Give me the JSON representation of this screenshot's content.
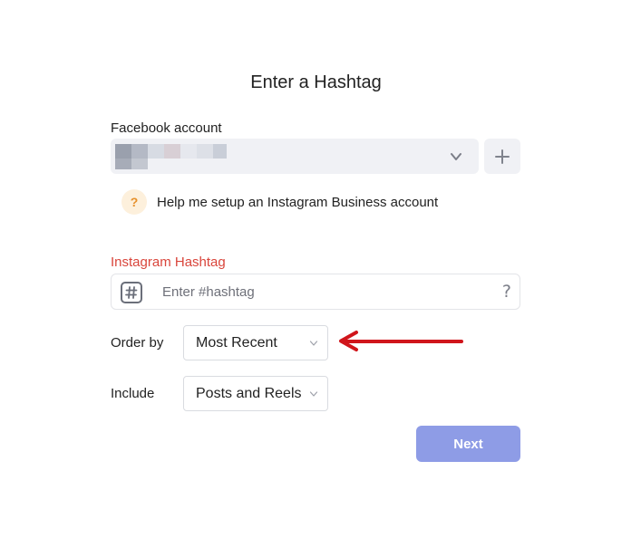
{
  "title": "Enter a Hashtag",
  "facebook": {
    "label": "Facebook account",
    "selected_account": "",
    "add_icon": "plus-icon",
    "dropdown_icon": "chevron-down-icon"
  },
  "help": {
    "icon_glyph": "?",
    "text": "Help me setup an Instagram Business account"
  },
  "instagram": {
    "label": "Instagram Hashtag",
    "label_color": "#d9453b",
    "placeholder": "Enter #hashtag",
    "value": "",
    "prefix_icon": "hash-icon",
    "help_glyph": "?"
  },
  "order_by": {
    "label": "Order by",
    "selected": "Most Recent"
  },
  "include": {
    "label": "Include",
    "selected": "Posts and Reels"
  },
  "next_button": {
    "label": "Next",
    "color": "#8e9ce6"
  },
  "colors": {
    "field_bg": "#f0f1f5",
    "annotation_arrow": "#d0151b",
    "help_icon_bg": "#fdf0dc",
    "help_icon_fg": "#e6902b"
  }
}
